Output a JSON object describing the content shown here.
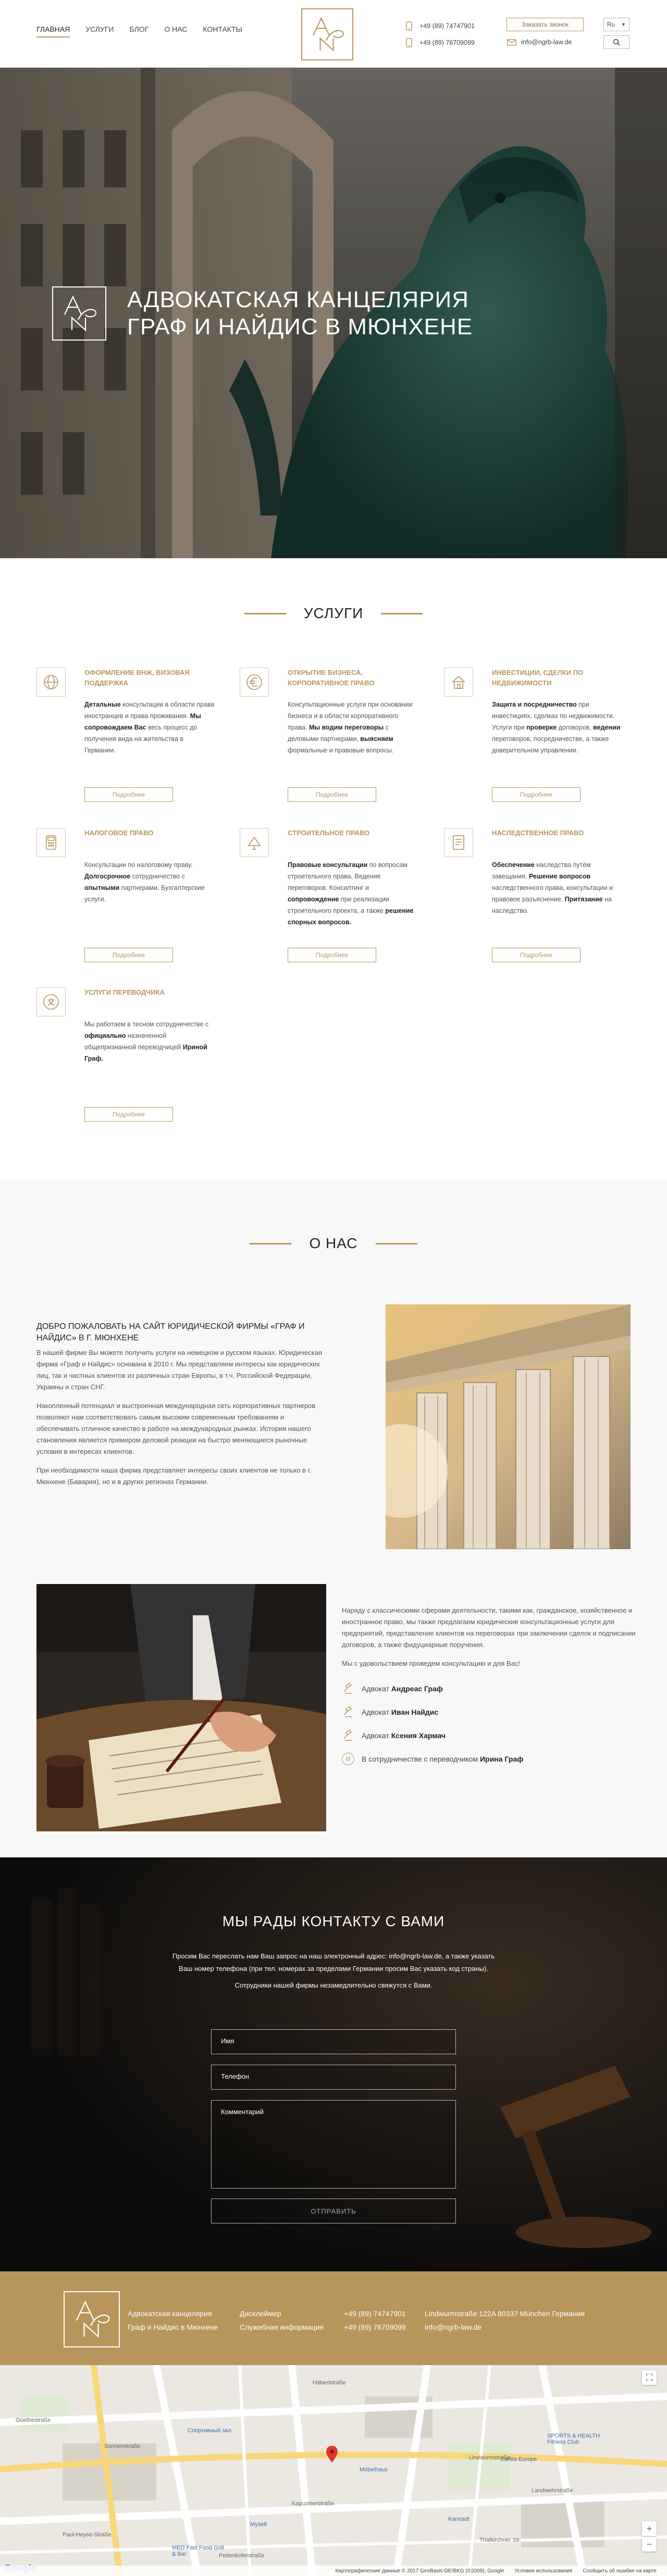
{
  "header": {
    "nav": [
      {
        "label": "ГЛАВНАЯ",
        "active": true
      },
      {
        "label": "УСЛУГИ",
        "active": false
      },
      {
        "label": "БЛОГ",
        "active": false
      },
      {
        "label": "О НАС",
        "active": false
      },
      {
        "label": "КОНТАКТЫ",
        "active": false
      }
    ],
    "phone1": "+49 (89) 74747901",
    "phone2": "+49 (89) 76709099",
    "email": "info@ngrb-law.de",
    "call_button": "Заказать звонок",
    "lang": "Ru"
  },
  "hero": {
    "title": "Адвокатская канцелярия Граф и Найдис в Мюнхене"
  },
  "services": {
    "title": "УСЛУГИ",
    "more_label": "Подробнее",
    "items": [
      {
        "icon": "globe-icon",
        "title": "Оформление ВНЖ, визовая поддержка",
        "html": "<b>Детальные</b> консультации в области права иностранцев и права проживания. <b>Мы сопровождаем Вас</b> весь процесс до получения вида на жительства в Германии."
      },
      {
        "icon": "euro-icon",
        "title": "Открытие бизнеса, корпоративное право",
        "html": "Консультационные услуги при основании бизнеса и в области корпоративного права. <b>Мы водим переговоры</b> с деловыми партнерами, <b>выясняем</b> формальные и правовые вопросы."
      },
      {
        "icon": "house-icon",
        "title": "Инвестиции, сделки по недвижимости",
        "html": "<b>Защита и посредничество</b> при инвестициях, сделках по недвижимости. Услуги при <b>проверке</b> договоров, <b>ведении</b> переговоров, посредничестве, а также доверительном управлении."
      },
      {
        "icon": "calculator-icon",
        "title": "Налоговое право",
        "html": "Консультации по налоговому праву. <b>Долгосрочное</b> сотрудничество с <b>опытными</b> партнерами. Бухгалтерские услуги."
      },
      {
        "icon": "trowel-icon",
        "title": "Строительное право",
        "html": "<b>Правовые консультации</b> по вопросам строительного права. Ведение переговоров. Консалтинг и <b>сопровождение</b> при реализации строительного проекта, а также <b>решение спорных вопросов.</b>"
      },
      {
        "icon": "document-icon",
        "title": "Наследственное право",
        "html": "<b>Обеспечение</b> наследства путём завещания. <b>Решение вопросов</b> наследственного права, консультации и правовое разъяснение. <b>Притязание</b> на наследство."
      },
      {
        "icon": "translate-icon",
        "title": "Услуги переводчика",
        "html": "Мы работаем в тесном сотрудничестве с <b>официально</b> назначенной общепризнанной переводчицей <b>Ириной Граф.</b>"
      }
    ]
  },
  "about": {
    "title": "О НАС",
    "heading": "Добро пожаловать на сайт юридической фирмы «Граф и Найдис» в г. Мюнхене",
    "p1": "В нашей фирме Вы можете получить услуги на немецком и русском языках. Юридическая фирма «Граф и Найдис» основана в 2010 г. Мы представляем интересы как юридических лиц, так и частных клиентов из различных стран Европы, в т.ч. Российской Федерации, Украины и стран СНГ.",
    "p2": "Накопленный потенциал и выстроенная международная сеть корпоративных партнеров позволяют нам соответствовать самым высоким современным требованиям и обеспечивать отличное качество в работе на международных рынках. История нашего становления является примером деловой реакции на быстро меняющиеся рыночные условия в интересах клиентов.",
    "p3": "При необходимости наша фирма представляет интересы своих клиентов не только в г. Мюнхене (Бавария), но и в других регионах Германии.",
    "p4": "Наряду с классическими сферами деятельности, такими как, гражданское, хозяйственное и иностранное право, мы также предлагаем юридические консультационные услуги для предприятий, представление клиентов на переговорах при заключении сделок и подписании договоров, а также фидуциарные поручения.",
    "p5": "Мы с удовольствием проведем консультацию и для Вас!",
    "lawyers": [
      {
        "prefix": "Адвокат",
        "name": "Андреас Граф"
      },
      {
        "prefix": "Адвокат",
        "name": "Иван Найдис"
      },
      {
        "prefix": "Адвокат",
        "name": "Ксения Хармач"
      }
    ],
    "partner_prefix": "В сотрудничестве с переводчиком",
    "partner_name": "Ирина Граф"
  },
  "contact": {
    "title": "МЫ РАДЫ КОНТАКТУ С ВАМИ",
    "line1": "Просим Вас переслать нам Ваш запрос на наш электронный адрес: info@ngrb-law.de, а также указать",
    "line2": "Ваш номер телефона (при тел. номерах за пределами Германии просим Вас указать код страны).",
    "line3": "Сотрудники нашей фирмы незамедлительно свяжутся с Вами.",
    "name_placeholder": "Имя",
    "phone_placeholder": "Телефон",
    "comment_placeholder": "Комментарий",
    "send": "Отправить"
  },
  "footer": {
    "company1": "Адвокатская канцелярия",
    "company2": "Граф и Найдис в Мюнхене",
    "disclaimer": "Дисклеймер",
    "service_info": "Служебная информация",
    "phone1": "+49 (89) 74747901",
    "phone2": "+49 (89) 76709099",
    "address": "Lindwurmstraße 122A 80337 München Германия",
    "email": "info@ngrb-law.de"
  },
  "map": {
    "streets": [
      "Goethestraße",
      "Häberlstraße",
      "Sonnenstraße",
      "Lindwurmstraße",
      "Kapuzinerstraße",
      "Thalkirchner Str.",
      "Pettenkoferstraße",
      "Landwehrstraße",
      "Paul-Heyse-Straße"
    ],
    "pois": [
      "Спортивный зал",
      "SPORTS & HEALTH Fitness Club",
      "Carlita Europe",
      "Möbelhaus",
      "Karstadt",
      "Музей",
      "MED Fast Food Grill & Bar"
    ],
    "footer_text": "Картографические данные © 2017 GeoBasis-DE/BKG (©2009), Google",
    "terms": "Условия использования",
    "report": "Сообщить об ошибке на карте"
  }
}
